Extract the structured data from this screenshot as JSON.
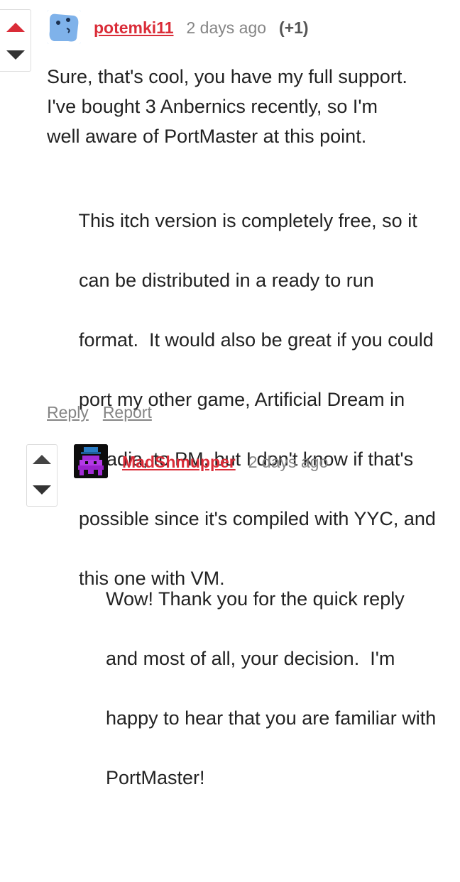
{
  "comments": [
    {
      "author": "potemki11",
      "time": "2 days ago",
      "score": "(+1)",
      "paragraphs": [
        [
          "Sure, that's cool, you have my full support.",
          "I've bought 3 Anbernics recently, so I'm",
          "well aware of PortMaster at this point."
        ],
        [
          "This itch version is completely free, so it",
          "can be distributed in a ready to run",
          "format.  It would also be great if you could",
          "port my other game, Artificial Dream in",
          "Arcadia, to PM, but I don't know if that's",
          "possible since it's compiled with YYC, and",
          "this one with VM."
        ]
      ],
      "actions": {
        "reply": "Reply",
        "report": "Report"
      },
      "avatar_icon": "blue-blob-avatar",
      "upvote_color": "#da2c38"
    },
    {
      "author": "MadShmupper",
      "time": "2 days ago",
      "paragraphs": [
        [
          "Wow! Thank you for the quick reply",
          "and most of all, your decision.  I'm",
          "happy to hear that you are familiar with",
          "PortMaster!"
        ]
      ],
      "avatar_icon": "purple-invader-avatar",
      "upvote_color": "#444444"
    }
  ],
  "colors": {
    "accent": "#da2c38",
    "muted": "#858585",
    "text": "#222222"
  }
}
